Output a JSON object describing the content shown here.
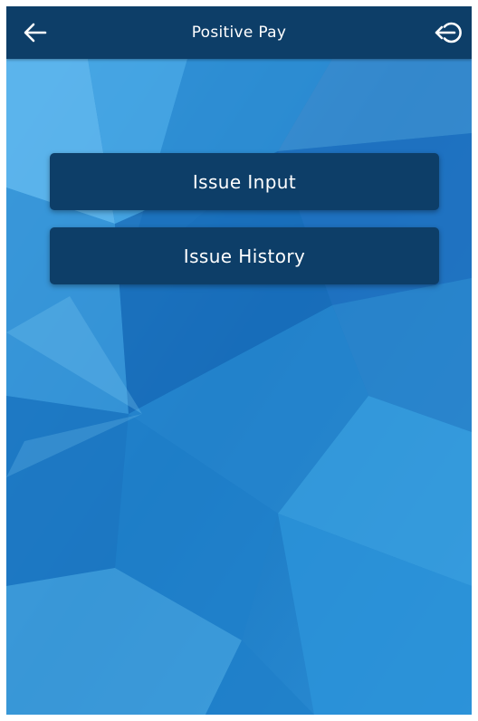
{
  "header": {
    "title": "Positive Pay",
    "back_icon": "arrow-left-icon",
    "logout_icon": "logout-icon"
  },
  "menu": {
    "items": [
      {
        "label": "Issue Input"
      },
      {
        "label": "Issue History"
      }
    ]
  },
  "colors": {
    "header_bg": "#0d3e68",
    "button_bg": "#0d3e68",
    "text": "#ffffff",
    "background_base": "#1b7cc4"
  }
}
